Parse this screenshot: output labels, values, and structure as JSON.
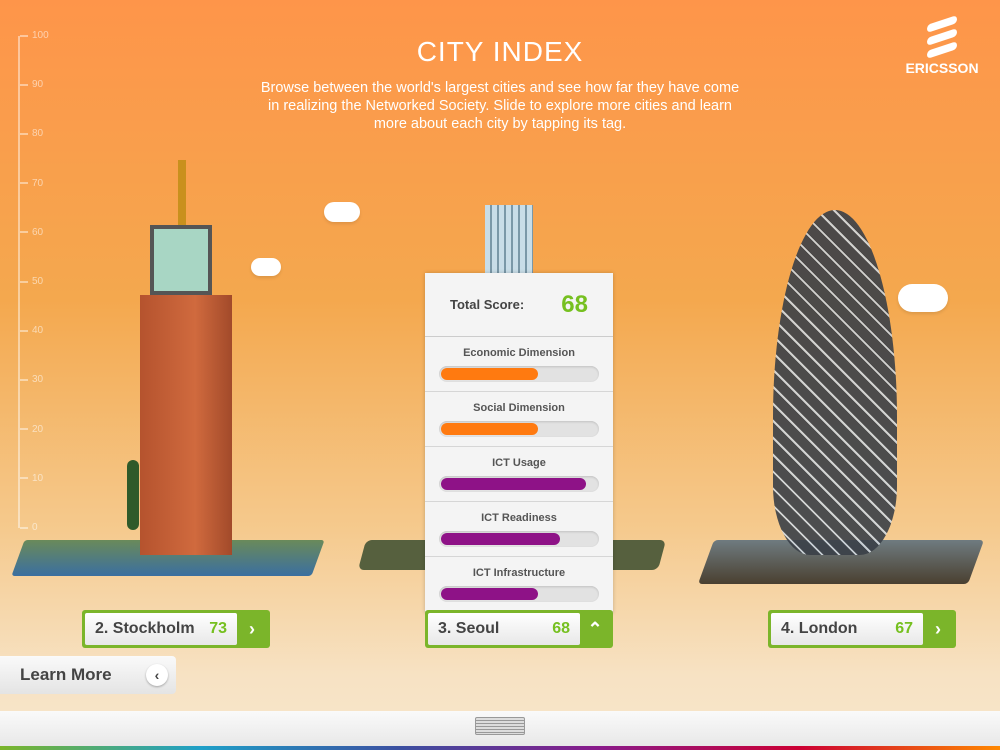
{
  "header": {
    "title": "CITY INDEX",
    "description": "Browse between the world's largest cities and see how far they have come in realizing the Networked Society. Slide to explore more cities and learn more about each city by tapping its tag.",
    "logo_text": "ERICSSON"
  },
  "scale": {
    "ticks": [
      "100",
      "90",
      "80",
      "70",
      "60",
      "50",
      "40",
      "30",
      "20",
      "10",
      "0"
    ]
  },
  "cities": [
    {
      "label": "2. Stockholm",
      "score": "73",
      "arrow": "›"
    },
    {
      "label": "3. Seoul",
      "score": "68",
      "arrow": "⌃"
    },
    {
      "label": "4. London",
      "score": "67",
      "arrow": "›"
    }
  ],
  "panel": {
    "total_label": "Total Score:",
    "total_value": "68",
    "dimensions": [
      {
        "label": "Economic Dimension",
        "value": 0.62,
        "color": "#ff7a10"
      },
      {
        "label": "Social Dimension",
        "value": 0.62,
        "color": "#ff7a10"
      },
      {
        "label": "ICT Usage",
        "value": 0.93,
        "color": "#8e1287"
      },
      {
        "label": "ICT Readiness",
        "value": 0.76,
        "color": "#8e1287"
      },
      {
        "label": "ICT Infrastructure",
        "value": 0.62,
        "color": "#8e1287"
      }
    ]
  },
  "learn_more": {
    "label": "Learn More",
    "icon": "‹"
  }
}
